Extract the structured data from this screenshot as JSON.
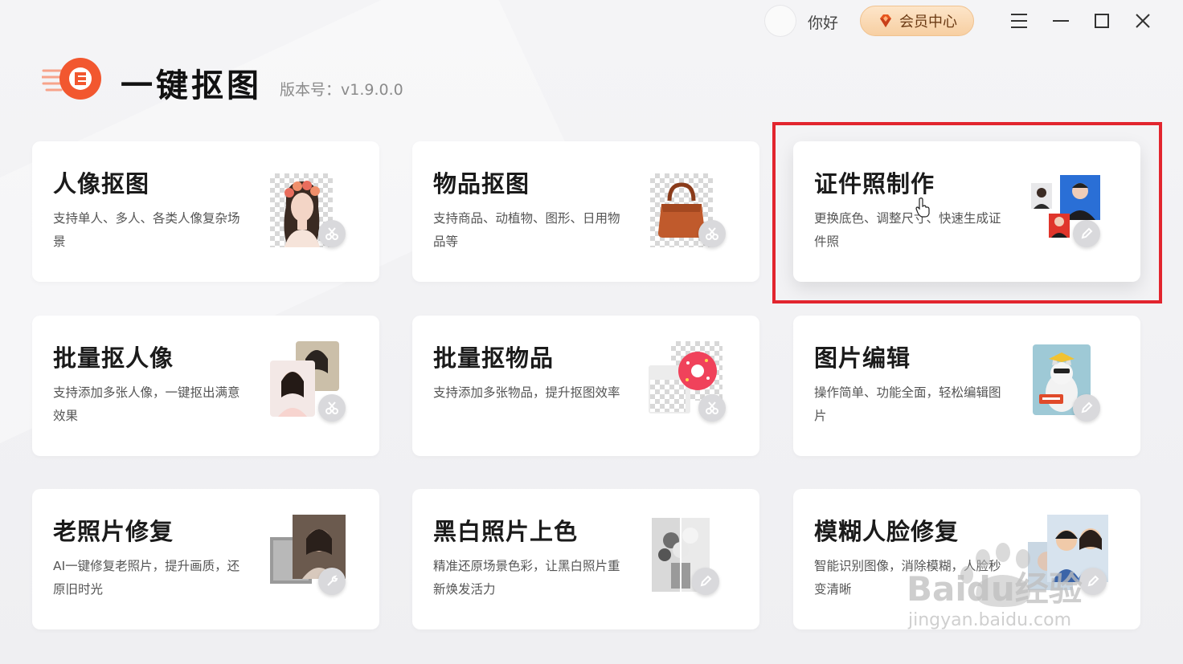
{
  "header": {
    "greeting": "你好",
    "vip_label": "会员中心",
    "app_name": "一键抠图",
    "version": "版本号：v1.9.0.0"
  },
  "cards": [
    {
      "title": "人像抠图",
      "desc": "支持单人、多人、各类人像复杂场景",
      "icon": "portrait-cutout-icon"
    },
    {
      "title": "物品抠图",
      "desc": "支持商品、动植物、图形、日用物品等",
      "icon": "object-cutout-icon"
    },
    {
      "title": "证件照制作",
      "desc": "更换底色、调整尺寸、快速生成证件照",
      "icon": "id-photo-icon"
    },
    {
      "title": "批量抠人像",
      "desc": "支持添加多张人像，一键抠出满意效果",
      "icon": "batch-portrait-icon"
    },
    {
      "title": "批量抠物品",
      "desc": "支持添加多张物品，提升抠图效率",
      "icon": "batch-object-icon"
    },
    {
      "title": "图片编辑",
      "desc": "操作简单、功能全面，轻松编辑图片",
      "icon": "image-edit-icon"
    },
    {
      "title": "老照片修复",
      "desc": "AI一键修复老照片，提升画质，还原旧时光",
      "icon": "old-photo-repair-icon"
    },
    {
      "title": "黑白照片上色",
      "desc": "精准还原场景色彩，让黑白照片重新焕发活力",
      "icon": "colorize-icon"
    },
    {
      "title": "模糊人脸修复",
      "desc": "智能识别图像，消除模糊，人脸秒变清晰",
      "icon": "face-restore-icon"
    }
  ],
  "watermark": {
    "brand": "Baidu经验",
    "url": "jingyan.baidu.com"
  },
  "colors": {
    "accent": "#f2572f",
    "highlight": "#e2252e",
    "vip_bg": "#f7cfa2"
  }
}
